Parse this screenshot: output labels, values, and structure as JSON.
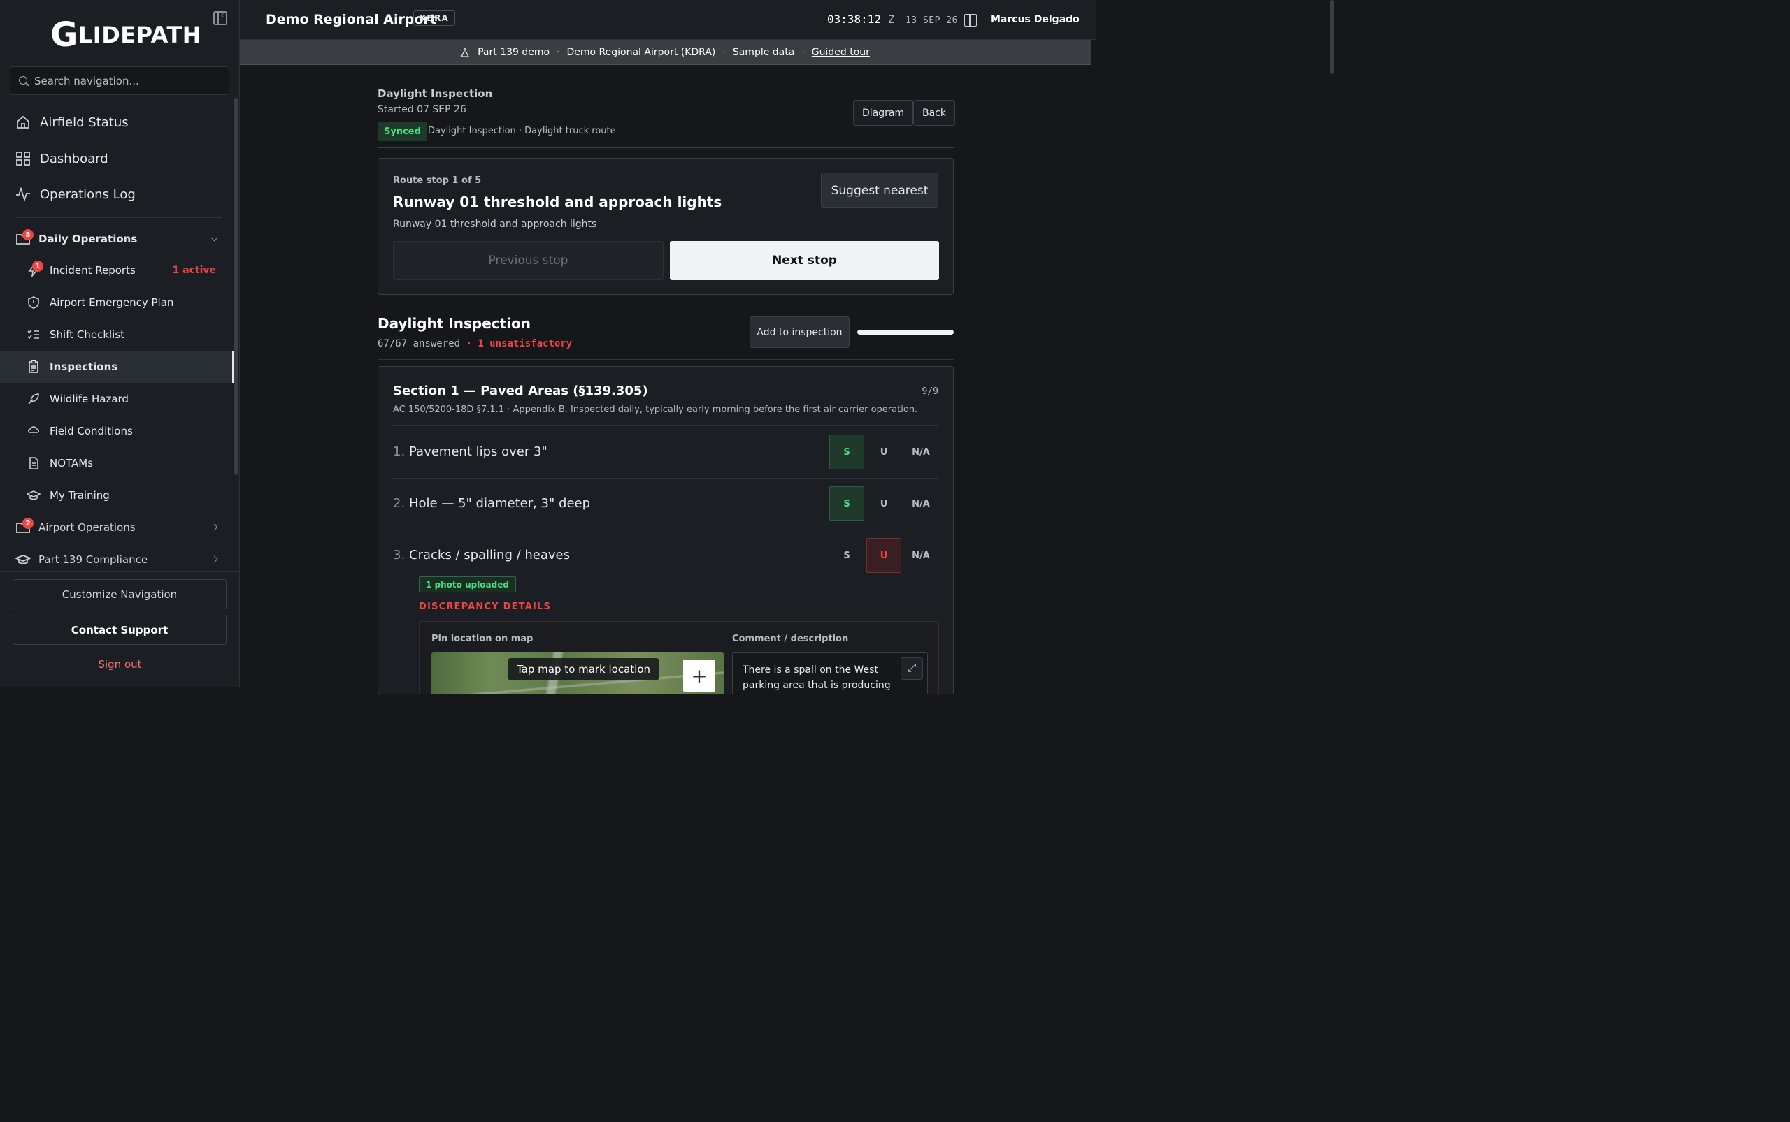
{
  "app": {
    "logo": "GLIDEPATH",
    "logo_g": "G",
    "logo_rest": "LIDEPATH"
  },
  "search": {
    "placeholder": "Search navigation..."
  },
  "nav_top": [
    {
      "label": "Airfield Status",
      "icon": "home-icon"
    },
    {
      "label": "Dashboard",
      "icon": "dashboard-icon"
    },
    {
      "label": "Operations Log",
      "icon": "activity-icon"
    }
  ],
  "daily_operations": {
    "label": "Daily Operations",
    "badge": "5",
    "items": [
      {
        "label": "Incident Reports",
        "icon": "incident-icon",
        "badge": "1",
        "status": "1 active"
      },
      {
        "label": "Airport Emergency Plan",
        "icon": "shield-icon"
      },
      {
        "label": "Shift Checklist",
        "icon": "checklist-icon"
      },
      {
        "label": "Inspections",
        "icon": "clipboard-icon",
        "active": true
      },
      {
        "label": "Wildlife Hazard",
        "icon": "bird-icon"
      },
      {
        "label": "Field Conditions",
        "icon": "cloud-icon"
      },
      {
        "label": "NOTAMs",
        "icon": "document-icon"
      },
      {
        "label": "My Training",
        "icon": "graduation-cap-icon"
      }
    ]
  },
  "airport_operations": {
    "label": "Airport Operations",
    "badge": "2"
  },
  "part139": {
    "label": "Part 139 Compliance"
  },
  "footer": {
    "customize": "Customize Navigation",
    "support": "Contact Support",
    "signout": "Sign out"
  },
  "topbar": {
    "airport": "Demo Regional Airport",
    "code": "KDRA",
    "time": "03:38:12",
    "zone": "Z",
    "date": "13 SEP 26",
    "user": "Marcus Delgado"
  },
  "demobar": {
    "mode": "Part 139 demo",
    "airport": "Demo Regional Airport (KDRA)",
    "data": "Sample data",
    "tour": "Guided tour"
  },
  "inspection": {
    "title": "Daylight Inspection",
    "started": "Started 07 SEP 26",
    "sync_status": "Synced",
    "meta": "Daylight Inspection · Daylight truck route",
    "diagram_btn": "Diagram",
    "back_btn": "Back"
  },
  "route": {
    "stop_label": "Route stop 1 of 5",
    "stop_name": "Runway 01 threshold and approach lights",
    "stop_desc": "Runway 01 threshold and approach lights",
    "suggest_btn": "Suggest nearest",
    "prev_btn": "Previous stop",
    "next_btn": "Next stop"
  },
  "checklist": {
    "title": "Daylight Inspection",
    "answered": "67/67 answered",
    "separator": "·",
    "unsatisfactory": "1 unsatisfactory",
    "add_btn": "Add to inspection",
    "progress": 1.0
  },
  "section": {
    "title": "Section 1 — Paved Areas (§139.305)",
    "count": "9/9",
    "desc": "AC 150/5200-18D §7.1.1 · Appendix B. Inspected daily, typically early morning before the first air carrier operation.",
    "answer_labels": {
      "s": "S",
      "u": "U",
      "na": "N/A"
    },
    "items": [
      {
        "num": "1.",
        "text": "Pavement lips over 3\"",
        "answer": "S"
      },
      {
        "num": "2.",
        "text": "Hole — 5\" diameter, 3\" deep",
        "answer": "S"
      },
      {
        "num": "3.",
        "text": "Cracks / spalling / heaves",
        "answer": "U"
      }
    ]
  },
  "discrepancy": {
    "photo_tag": "1 photo uploaded",
    "title": "DISCREPANCY DETAILS",
    "pin_label": "Pin location on map",
    "map_hint": "Tap map to mark location",
    "zoom_in": "+",
    "comment_label": "Comment / description",
    "comment": "There is a spall on the West parking area that is producing"
  },
  "colors": {
    "accent_green": "#4ade80",
    "accent_red": "#ef4444",
    "background": "#15171b",
    "panel": "#1b1e23"
  }
}
